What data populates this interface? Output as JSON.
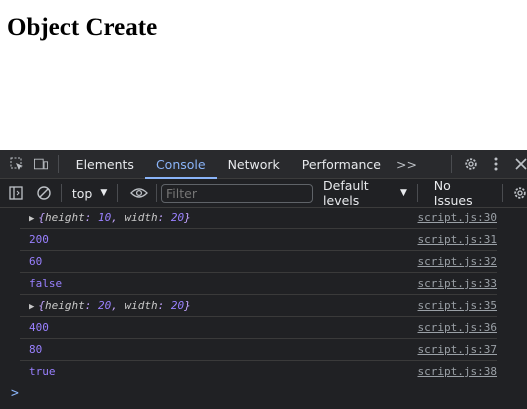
{
  "page": {
    "title": "Object Create"
  },
  "devtools": {
    "tabs": [
      {
        "label": "Elements"
      },
      {
        "label": "Console"
      },
      {
        "label": "Network"
      },
      {
        "label": "Performance"
      }
    ],
    "more_tabs": ">>",
    "toolbar": {
      "context": "top",
      "filter_placeholder": "Filter",
      "levels": "Default levels",
      "issues": "No Issues"
    },
    "logs": [
      {
        "type": "object",
        "k1": "height",
        "v1": "10",
        "k2": "width",
        "v2": "20",
        "src": "script.js:30"
      },
      {
        "type": "number",
        "text": "200",
        "src": "script.js:31"
      },
      {
        "type": "number",
        "text": "60",
        "src": "script.js:32"
      },
      {
        "type": "bool",
        "text": "false",
        "src": "script.js:33"
      },
      {
        "type": "object",
        "k1": "height",
        "v1": "20",
        "k2": "width",
        "v2": "20",
        "src": "script.js:35"
      },
      {
        "type": "number",
        "text": "400",
        "src": "script.js:36"
      },
      {
        "type": "number",
        "text": "80",
        "src": "script.js:37"
      },
      {
        "type": "bool",
        "text": "true",
        "src": "script.js:38"
      }
    ],
    "prompt": ">"
  }
}
